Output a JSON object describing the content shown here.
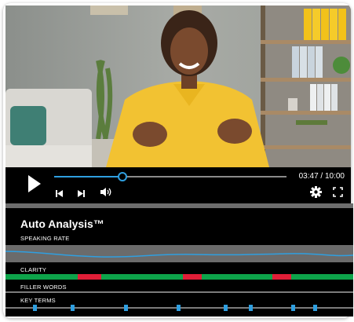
{
  "player": {
    "time": "03:47 / 10:00",
    "progress_fraction": 0.294,
    "colors": {
      "accent": "#2f9fe0",
      "bar_bg": "#000000"
    }
  },
  "controls": [
    {
      "icon": "play-icon"
    },
    {
      "icon": "skip-back-icon"
    },
    {
      "icon": "skip-forward-icon"
    },
    {
      "icon": "volume-icon"
    },
    {
      "icon": "gear-icon"
    },
    {
      "icon": "fullscreen-icon"
    }
  ],
  "analysis": {
    "title": "Auto Analysis™",
    "speaking_rate_label": "SPEAKING RATE",
    "clarity_label": "CLARITY",
    "filler_words_label": "FILLER WORDS",
    "key_terms_label": "KEY TERMS",
    "clarity_segments": [
      {
        "status": "good",
        "color": "#0da34a",
        "fraction": 0.207
      },
      {
        "status": "poor",
        "color": "#e01e37",
        "fraction": 0.068
      },
      {
        "status": "good",
        "color": "#0da34a",
        "fraction": 0.235
      },
      {
        "status": "poor",
        "color": "#e01e37",
        "fraction": 0.054
      },
      {
        "status": "good",
        "color": "#0da34a",
        "fraction": 0.203
      },
      {
        "status": "poor",
        "color": "#e01e37",
        "fraction": 0.054
      },
      {
        "status": "good",
        "color": "#0da34a",
        "fraction": 0.179
      }
    ],
    "key_term_positions_fraction": [
      0.084,
      0.191,
      0.345,
      0.496,
      0.633,
      0.704,
      0.826,
      0.89
    ],
    "speaking_rate_color": "#2f9fe0"
  }
}
